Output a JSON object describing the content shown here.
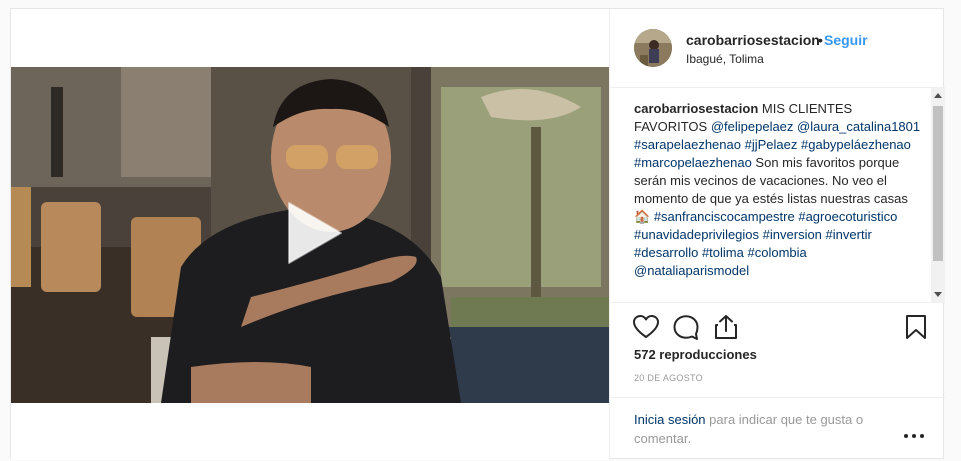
{
  "post": {
    "username": "carobarriosestacion",
    "separator": "•",
    "follow_label": "Seguir",
    "location": "Ibagué, Tolima",
    "caption": {
      "author": "carobarriosestacion",
      "parts": [
        {
          "t": "text",
          "v": " MIS CLIENTES FAVORITOS "
        },
        {
          "t": "link",
          "v": "@felipepelaez"
        },
        {
          "t": "text",
          "v": " "
        },
        {
          "t": "link",
          "v": "@laura_catalina1801"
        },
        {
          "t": "text",
          "v": " "
        },
        {
          "t": "link",
          "v": "#sarapelaezhenao"
        },
        {
          "t": "text",
          "v": " "
        },
        {
          "t": "link",
          "v": "#jjPelaez"
        },
        {
          "t": "text",
          "v": " "
        },
        {
          "t": "link",
          "v": "#gabypeláezhenao"
        },
        {
          "t": "text",
          "v": " "
        },
        {
          "t": "link",
          "v": "#marcopelaezhenao"
        },
        {
          "t": "text",
          "v": " Son mis favoritos porque serán mis vecinos de vacaciones. No veo el momento de que ya estés listas nuestras casas 🏠 "
        },
        {
          "t": "link",
          "v": "#sanfranciscocampestre"
        },
        {
          "t": "text",
          "v": " "
        },
        {
          "t": "link",
          "v": "#agroecoturistico"
        },
        {
          "t": "text",
          "v": " "
        },
        {
          "t": "link",
          "v": "#unavidadeprivilegios"
        },
        {
          "t": "text",
          "v": " "
        },
        {
          "t": "link",
          "v": "#inversion"
        },
        {
          "t": "text",
          "v": " "
        },
        {
          "t": "link",
          "v": "#invertir"
        },
        {
          "t": "text",
          "v": " "
        },
        {
          "t": "link",
          "v": "#desarrollo"
        },
        {
          "t": "text",
          "v": " "
        },
        {
          "t": "link",
          "v": "#tolima"
        },
        {
          "t": "text",
          "v": " "
        },
        {
          "t": "link",
          "v": "#colombia"
        },
        {
          "t": "text",
          "v": " "
        },
        {
          "t": "link",
          "v": "@nataliaparismodel"
        }
      ]
    },
    "views": "572 reproducciones",
    "date": "20 DE AGOSTO",
    "login": {
      "link": "Inicia sesión",
      "rest": " para indicar que te gusta o comentar."
    }
  },
  "icons": {
    "play": "play-icon",
    "like": "heart-icon",
    "comment": "comment-icon",
    "share": "share-icon",
    "save": "bookmark-icon",
    "more": "more-options-icon"
  },
  "colors": {
    "link": "#003569",
    "follow": "#3897f0",
    "muted": "#999999",
    "border": "#efefef"
  }
}
